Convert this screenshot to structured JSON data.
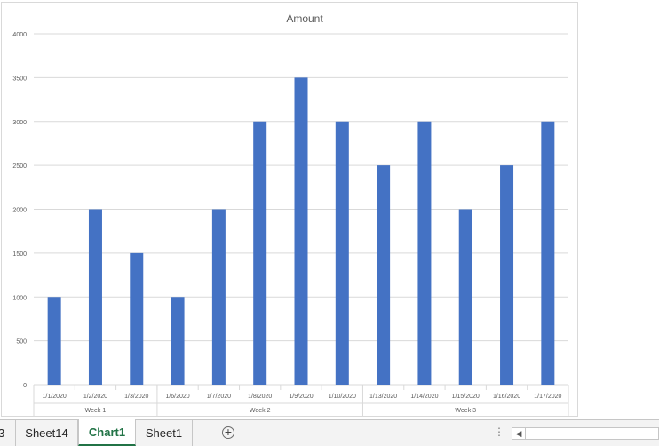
{
  "chart_data": {
    "type": "bar",
    "title": "Amount",
    "categories": [
      "1/1/2020",
      "1/2/2020",
      "1/3/2020",
      "1/6/2020",
      "1/7/2020",
      "1/8/2020",
      "1/9/2020",
      "1/10/2020",
      "1/13/2020",
      "1/14/2020",
      "1/15/2020",
      "1/16/2020",
      "1/17/2020"
    ],
    "groups": [
      {
        "label": "Week 1",
        "count": 3
      },
      {
        "label": "Week 2",
        "count": 5
      },
      {
        "label": "Week 3",
        "count": 5
      }
    ],
    "series": [
      {
        "values": [
          1000,
          2000,
          1500,
          1000,
          2000,
          3000,
          3500,
          3000,
          2500,
          3000,
          2000,
          2500,
          3000
        ]
      }
    ],
    "ylim": [
      0,
      4000
    ],
    "yticks": [
      0,
      500,
      1000,
      1500,
      2000,
      2500,
      3000,
      3500,
      4000
    ],
    "grid": true,
    "bar_color": "#4472c4"
  },
  "sheet_tabs": {
    "partial_label": "3",
    "tabs": [
      {
        "label": "Sheet14",
        "active": false
      },
      {
        "label": "Chart1",
        "active": true
      },
      {
        "label": "Sheet1",
        "active": false
      }
    ],
    "add_symbol": "+",
    "menu_dots": "⋮",
    "scroll_left_arrow": "◀"
  }
}
